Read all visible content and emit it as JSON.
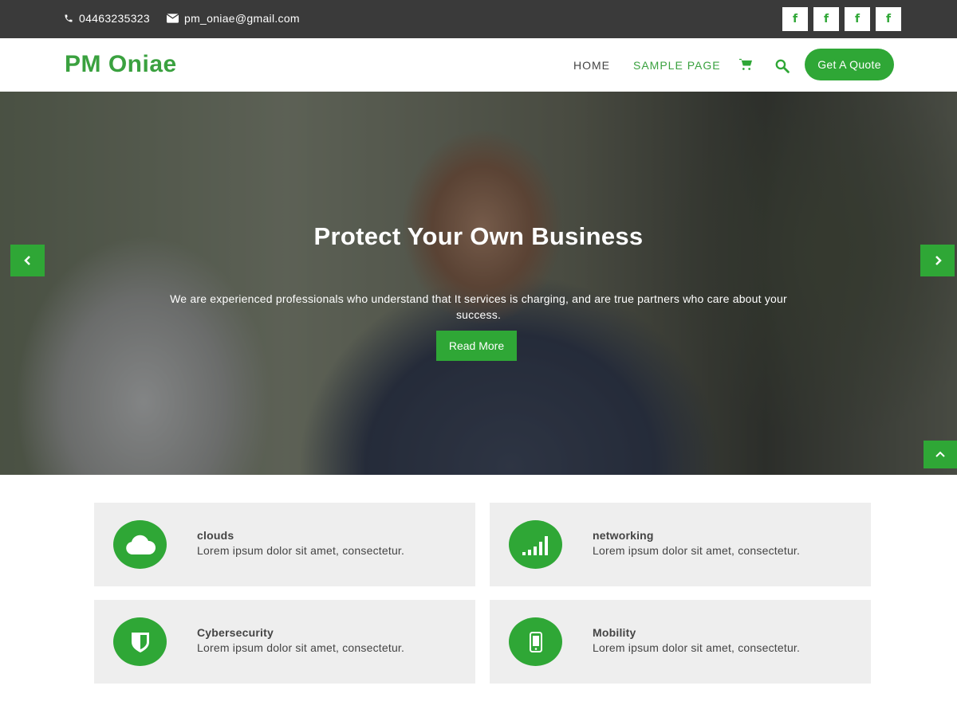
{
  "topbar": {
    "phone": "04463235323",
    "email": "pm_oniae@gmail.com",
    "socials": [
      "f",
      "f",
      "f",
      "f"
    ]
  },
  "header": {
    "logo": "PM Oniae",
    "nav": {
      "home": "HOME",
      "sample_page": "SAMPLE PAGE"
    },
    "quote_button": "Get A Quote"
  },
  "hero": {
    "title": "Protect Your Own Business",
    "text": "We are experienced professionals who understand that It services is charging, and are true partners who care about your success.",
    "button": "Read More"
  },
  "services": [
    {
      "title": "clouds",
      "desc": "Lorem ipsum dolor sit amet, consectetur.",
      "icon": "cloud-icon"
    },
    {
      "title": "networking",
      "desc": "Lorem ipsum dolor sit amet, consectetur.",
      "icon": "signal-icon"
    },
    {
      "title": "Cybersecurity",
      "desc": "Lorem ipsum dolor sit amet, consectetur.",
      "icon": "shield-icon"
    },
    {
      "title": "Mobility",
      "desc": "Lorem ipsum dolor sit amet, consectetur.",
      "icon": "mobile-icon"
    }
  ],
  "colors": {
    "accent": "#2fa736",
    "topbar": "#3a3a3a",
    "card_bg": "#eeeeee"
  }
}
